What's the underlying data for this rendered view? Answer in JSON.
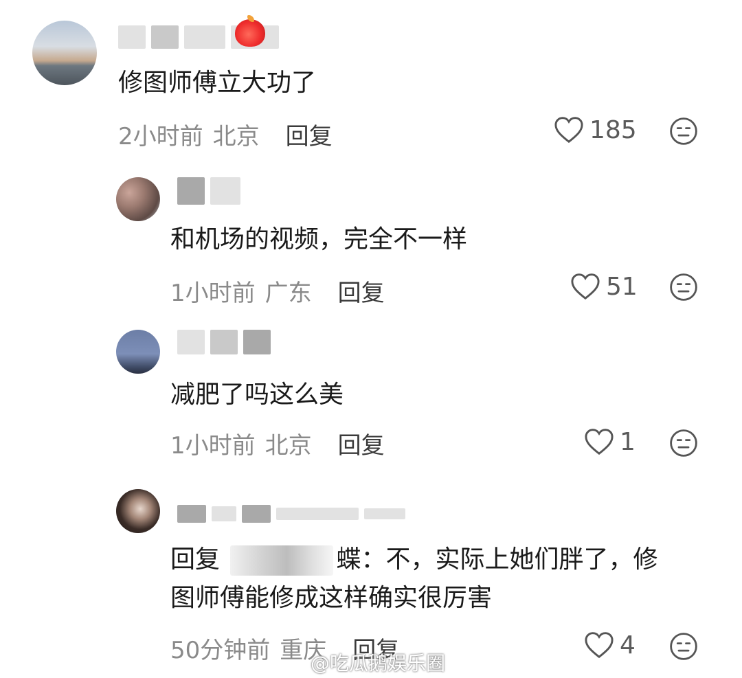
{
  "comments": [
    {
      "text": "修图师傅立大功了",
      "time": "2小时前",
      "location": "北京",
      "reply_label": "回复",
      "likes": "185"
    },
    {
      "text": "和机场的视频，完全不一样",
      "time": "1小时前",
      "location": "广东",
      "reply_label": "回复",
      "likes": "51"
    },
    {
      "text": "减肥了吗这么美",
      "time": "1小时前",
      "location": "北京",
      "reply_label": "回复",
      "likes": "1"
    },
    {
      "reply_prefix": "回复",
      "reply_name_tail": "蝶",
      "text_line1": "：不，实际上她们胖了，修",
      "text_line2": "图师傅能修成这样确实很厉害",
      "time": "50分钟前",
      "location": "重庆",
      "reply_label": "回复",
      "likes": "4"
    }
  ],
  "watermark": "@吃瓜鹅娱乐圈",
  "icons": {
    "like": "heart-outline-icon",
    "emoji": "neutral-face-icon"
  },
  "colors": {
    "text": "#1a1a1a",
    "meta": "#8a8a8a",
    "badge": "#ee2c2c"
  }
}
